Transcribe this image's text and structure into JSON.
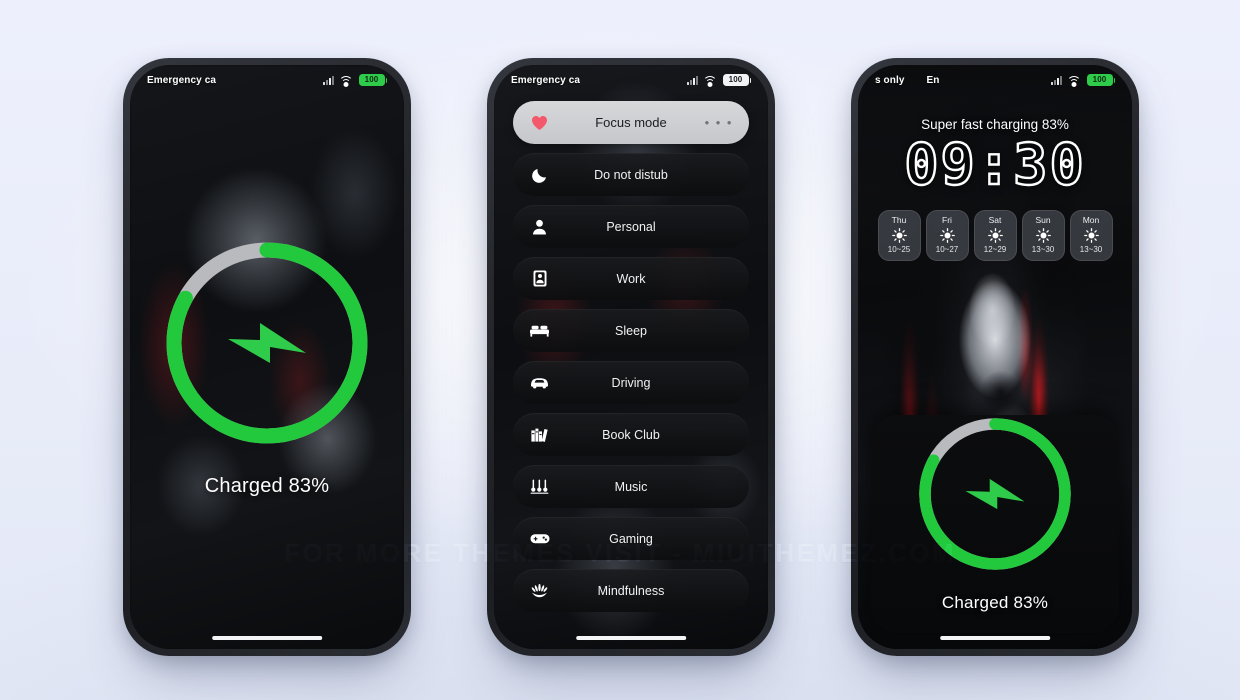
{
  "background_color": "#eaeefb",
  "accent_green": "#22c93c",
  "watermark": "FOR MORE THEMES VISIT - MIUITHEMEZ.COM",
  "phones": [
    {
      "name": "charging-lockscreen",
      "statusbar": {
        "left": [
          "Emergency ca"
        ],
        "battery": "100",
        "battery_style": "green",
        "icons": [
          "signal-icon",
          "wifi-icon",
          "battery-icon"
        ]
      },
      "charging": {
        "percent": 83,
        "label": "Charged 83%",
        "icon": "lightning-bolt-icon"
      }
    },
    {
      "name": "focus-mode-panel",
      "statusbar": {
        "left": [
          "Emergency ca"
        ],
        "battery": "100",
        "battery_style": "light",
        "icons": [
          "signal-icon",
          "wifi-icon",
          "battery-icon"
        ]
      },
      "focus": {
        "items": [
          {
            "label": "Focus mode",
            "icon": "heart-icon",
            "active": true,
            "more": "• • •"
          },
          {
            "label": "Do not distub",
            "icon": "moon-icon",
            "active": false
          },
          {
            "label": "Personal",
            "icon": "person-icon",
            "active": false
          },
          {
            "label": "Work",
            "icon": "briefcase-icon",
            "active": false
          },
          {
            "label": "Sleep",
            "icon": "bed-icon",
            "active": false
          },
          {
            "label": "Driving",
            "icon": "car-icon",
            "active": false
          },
          {
            "label": "Book Club",
            "icon": "books-icon",
            "active": false
          },
          {
            "label": "Music",
            "icon": "music-icon",
            "active": false
          },
          {
            "label": "Gaming",
            "icon": "gamepad-icon",
            "active": false
          },
          {
            "label": "Mindfulness",
            "icon": "lotus-hands-icon",
            "active": false
          }
        ]
      }
    },
    {
      "name": "lockscreen-widgets",
      "statusbar": {
        "left": [
          "s only",
          "En"
        ],
        "battery": "100",
        "battery_style": "green",
        "icons": [
          "signal-icon",
          "wifi-icon",
          "battery-icon"
        ]
      },
      "charging_text": "Super fast charging  83%",
      "clock": "09:30",
      "weather": [
        {
          "day": "Thu",
          "icon": "sun-icon",
          "temp": "10~25"
        },
        {
          "day": "Fri",
          "icon": "sun-icon",
          "temp": "10~27"
        },
        {
          "day": "Sat",
          "icon": "sun-icon",
          "temp": "12~29"
        },
        {
          "day": "Sun",
          "icon": "sun-icon",
          "temp": "13~30"
        },
        {
          "day": "Mon",
          "icon": "sun-icon",
          "temp": "13~30"
        }
      ],
      "charging": {
        "percent": 83,
        "label": "Charged 83%",
        "icon": "lightning-bolt-icon"
      }
    }
  ]
}
